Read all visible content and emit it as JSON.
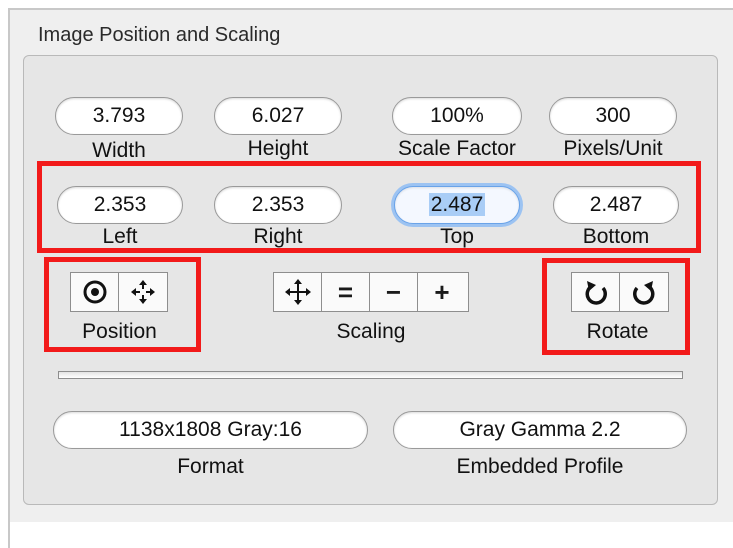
{
  "group": {
    "title": "Image Position and Scaling"
  },
  "size_fields": [
    {
      "value": "3.793",
      "label": "Width"
    },
    {
      "value": "6.027",
      "label": "Height"
    },
    {
      "value": "100%",
      "label": "Scale Factor"
    },
    {
      "value": "300",
      "label": "Pixels/Unit"
    }
  ],
  "margin_fields": [
    {
      "value": "2.353",
      "label": "Left"
    },
    {
      "value": "2.353",
      "label": "Right"
    },
    {
      "value": "2.487",
      "label": "Top",
      "focused": true
    },
    {
      "value": "2.487",
      "label": "Bottom"
    }
  ],
  "position_group": {
    "label": "Position",
    "buttons": [
      "center-target-icon",
      "move-arrows-icon"
    ]
  },
  "scaling_group": {
    "label": "Scaling",
    "buttons": [
      "fit-arrows-icon",
      "equals-icon",
      "minus-icon",
      "plus-icon"
    ],
    "equals": "=",
    "minus": "−",
    "plus": "+"
  },
  "rotate_group": {
    "label": "Rotate",
    "buttons": [
      "rotate-left-icon",
      "rotate-right-icon"
    ]
  },
  "info_fields": [
    {
      "value": "1138x1808 Gray:16",
      "label": "Format"
    },
    {
      "value": "Gray Gamma 2.2",
      "label": "Embedded Profile"
    }
  ],
  "colors": {
    "highlight": "#f21a1a",
    "focus_ring": "#9cc3f2",
    "selection": "#a9cdf6"
  }
}
